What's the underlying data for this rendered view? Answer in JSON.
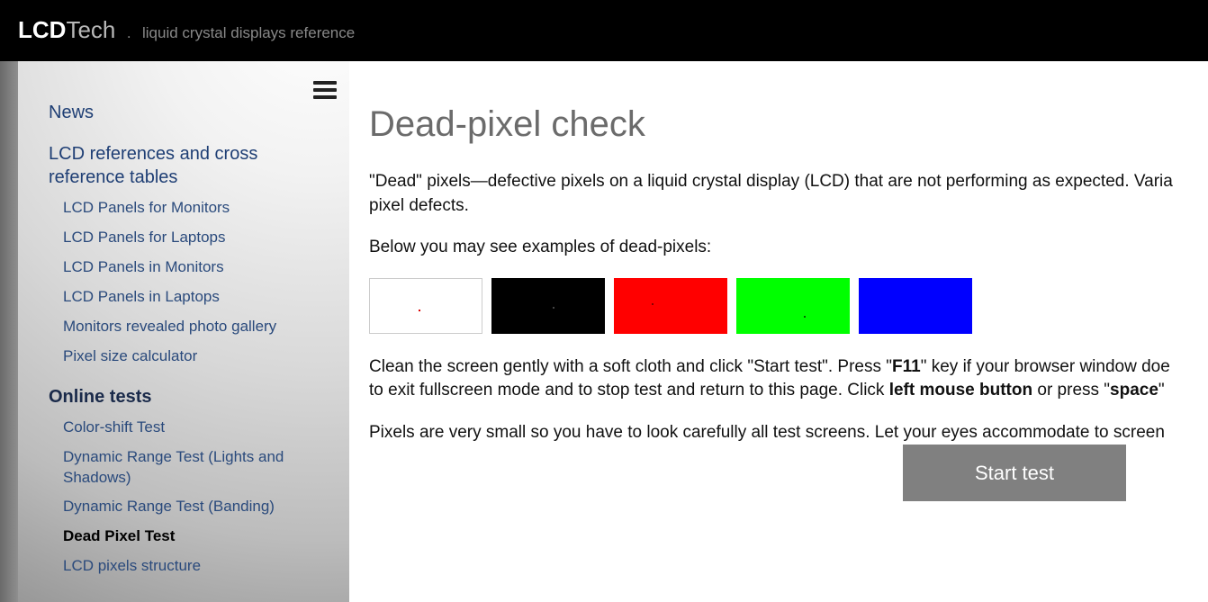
{
  "header": {
    "brand_main": "LCD",
    "brand_sub": "Tech",
    "dot": ".",
    "tagline": "liquid crystal displays reference"
  },
  "sidebar": {
    "top": [
      {
        "label": "News"
      },
      {
        "label": "LCD references and cross reference tables"
      }
    ],
    "refs": [
      "LCD Panels for Monitors",
      "LCD Panels for Laptops",
      "LCD Panels in Monitors",
      "LCD Panels in Laptops",
      "Monitors revealed photo gallery",
      "Pixel size calculator"
    ],
    "tests_heading": "Online tests",
    "tests": [
      "Color-shift Test",
      "Dynamic Range Test (Lights and Shadows)",
      "Dynamic Range Test (Banding)",
      "Dead Pixel Test",
      "LCD pixels structure"
    ],
    "active_test_index": 3
  },
  "main": {
    "title": "Dead-pixel check",
    "para1_a": "\"Dead\" pixels—defective pixels on a liquid crystal display (LCD) that are not performing as expected. Varia",
    "para1_b": "pixel defects.",
    "para2": "Below you may see examples of dead-pixels:",
    "swatch_colors": [
      "#ffffff",
      "#000000",
      "#ff0000",
      "#00ff00",
      "#0000ff"
    ],
    "para3_a": "Clean the screen gently with a soft cloth and click \"Start test\". Press \"",
    "para3_key1": "F11",
    "para3_b": "\" key if your browser window doe",
    "para3_c": "to exit fullscreen mode and to stop test and return to this page. Click ",
    "para3_key2": "left mouse button",
    "para3_d": " or press \"",
    "para3_key3": "space",
    "para3_e": "\"",
    "para4": "Pixels are very small so you have to look carefully all test screens. Let your eyes accommodate to screen ",
    "start_button": "Start test"
  }
}
